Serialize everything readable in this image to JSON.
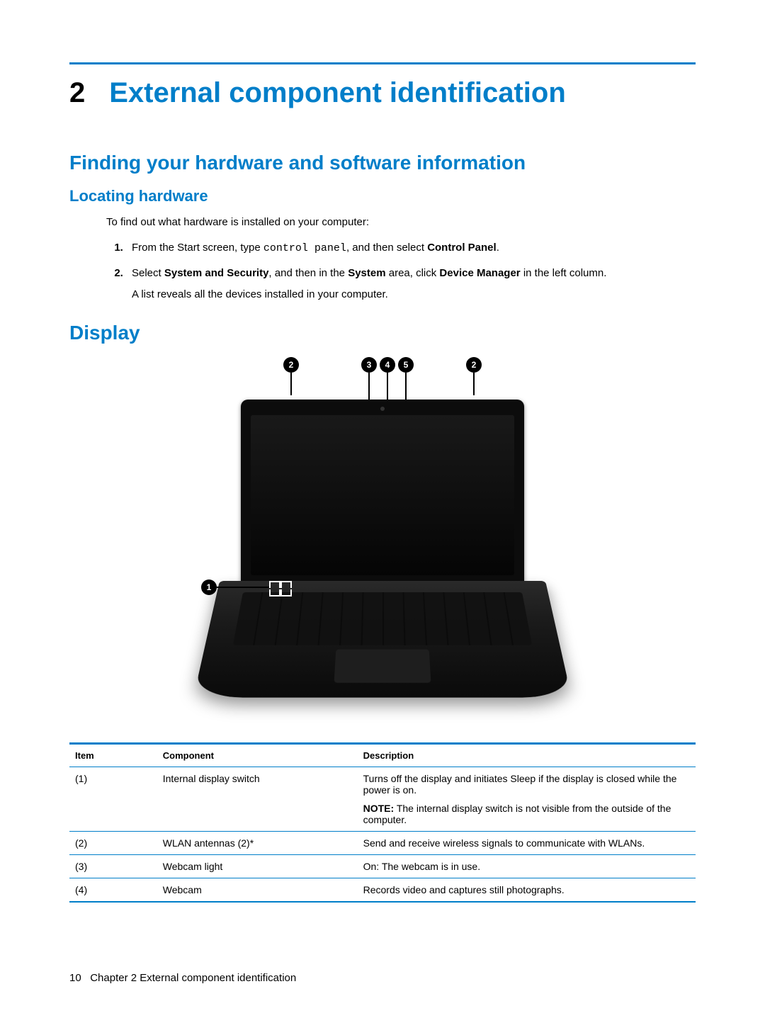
{
  "chapter": {
    "number": "2",
    "title": "External component identification"
  },
  "section1": {
    "heading": "Finding your hardware and software information",
    "sub": "Locating hardware",
    "intro": "To find out what hardware is installed on your computer:",
    "step1_pre": "From the Start screen, type ",
    "step1_code": "control panel",
    "step1_mid": ", and then select ",
    "step1_bold": "Control Panel",
    "step1_post": ".",
    "step2_a": "Select ",
    "step2_b1": "System and Security",
    "step2_c": ", and then in the ",
    "step2_b2": "System",
    "step2_d": " area, click ",
    "step2_b3": "Device Manager",
    "step2_e": " in the left column.",
    "step2_p": "A list reveals all the devices installed in your computer."
  },
  "section2": {
    "heading": "Display"
  },
  "callouts": {
    "c1": "1",
    "c2": "2",
    "c3": "3",
    "c4": "4",
    "c5": "5"
  },
  "table": {
    "headers": {
      "item": "Item",
      "component": "Component",
      "description": "Description"
    },
    "rows": [
      {
        "item": "(1)",
        "component": "Internal display switch",
        "description": "Turns off the display and initiates Sleep if the display is closed while the power is on.",
        "note_label": "NOTE:",
        "note": "The internal display switch is not visible from the outside of the computer."
      },
      {
        "item": "(2)",
        "component": "WLAN antennas (2)*",
        "description": "Send and receive wireless signals to communicate with WLANs."
      },
      {
        "item": "(3)",
        "component": "Webcam light",
        "description": "On: The webcam is in use."
      },
      {
        "item": "(4)",
        "component": "Webcam",
        "description": "Records video and captures still photographs."
      }
    ]
  },
  "footer": {
    "page": "10",
    "chapter_label": "Chapter 2   External component identification"
  }
}
